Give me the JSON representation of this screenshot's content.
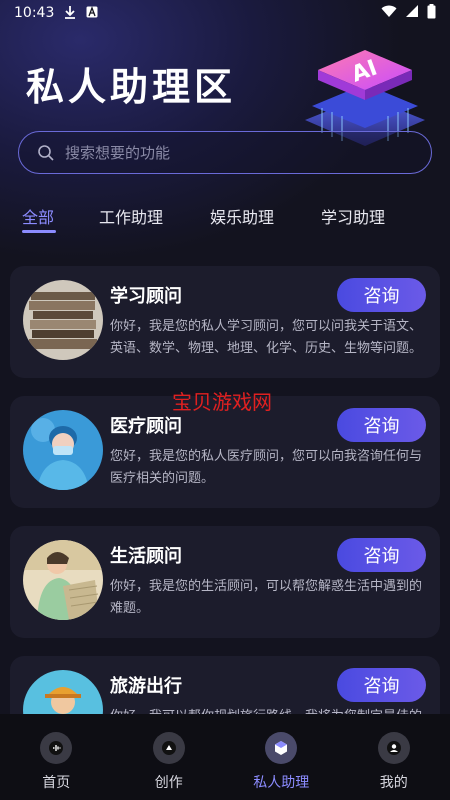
{
  "status_bar": {
    "time": "10:43",
    "left_icons": [
      "download-icon",
      "a-notification-icon"
    ],
    "right_icons": [
      "wifi-icon",
      "signal-icon",
      "battery-icon"
    ]
  },
  "header": {
    "title": "私人助理区",
    "art_text": "AI"
  },
  "search": {
    "placeholder": "搜索想要的功能"
  },
  "tabs": [
    {
      "label": "全部",
      "active": true
    },
    {
      "label": "工作助理",
      "active": false
    },
    {
      "label": "娱乐助理",
      "active": false
    },
    {
      "label": "学习助理",
      "active": false
    }
  ],
  "cards": [
    {
      "title": "学习顾问",
      "desc": "你好，我是您的私人学习顾问，您可以问我关于语文、英语、数学、物理、地理、化学、历史、生物等问题。",
      "button": "咨询",
      "avatar_icon": "books-avatar"
    },
    {
      "title": "医疗顾问",
      "desc": "您好，我是您的私人医疗顾问，您可以向我咨询任何与医疗相关的问题。",
      "button": "咨询",
      "avatar_icon": "nurse-avatar"
    },
    {
      "title": "生活顾问",
      "desc": "你好，我是您的生活顾问，可以帮您解惑生活中遇到的难题。",
      "button": "咨询",
      "avatar_icon": "lifestyle-avatar"
    },
    {
      "title": "旅游出行",
      "desc": "你好，我可以帮你规划旅行路线，我将为您制定最佳的出行方案。",
      "button": "咨询",
      "avatar_icon": "travel-avatar"
    }
  ],
  "watermark": "宝贝游戏网",
  "bottom_nav": [
    {
      "label": "首页",
      "icon": "home-icon",
      "active": false
    },
    {
      "label": "创作",
      "icon": "create-icon",
      "active": false
    },
    {
      "label": "私人助理",
      "icon": "assistant-icon",
      "active": true
    },
    {
      "label": "我的",
      "icon": "profile-icon",
      "active": false
    }
  ],
  "colors": {
    "accent": "#8c8cff",
    "button_gradient_start": "#4a4ae0",
    "button_gradient_end": "#6b5ae8",
    "background": "#13131f",
    "card": "#1c1c2c"
  }
}
